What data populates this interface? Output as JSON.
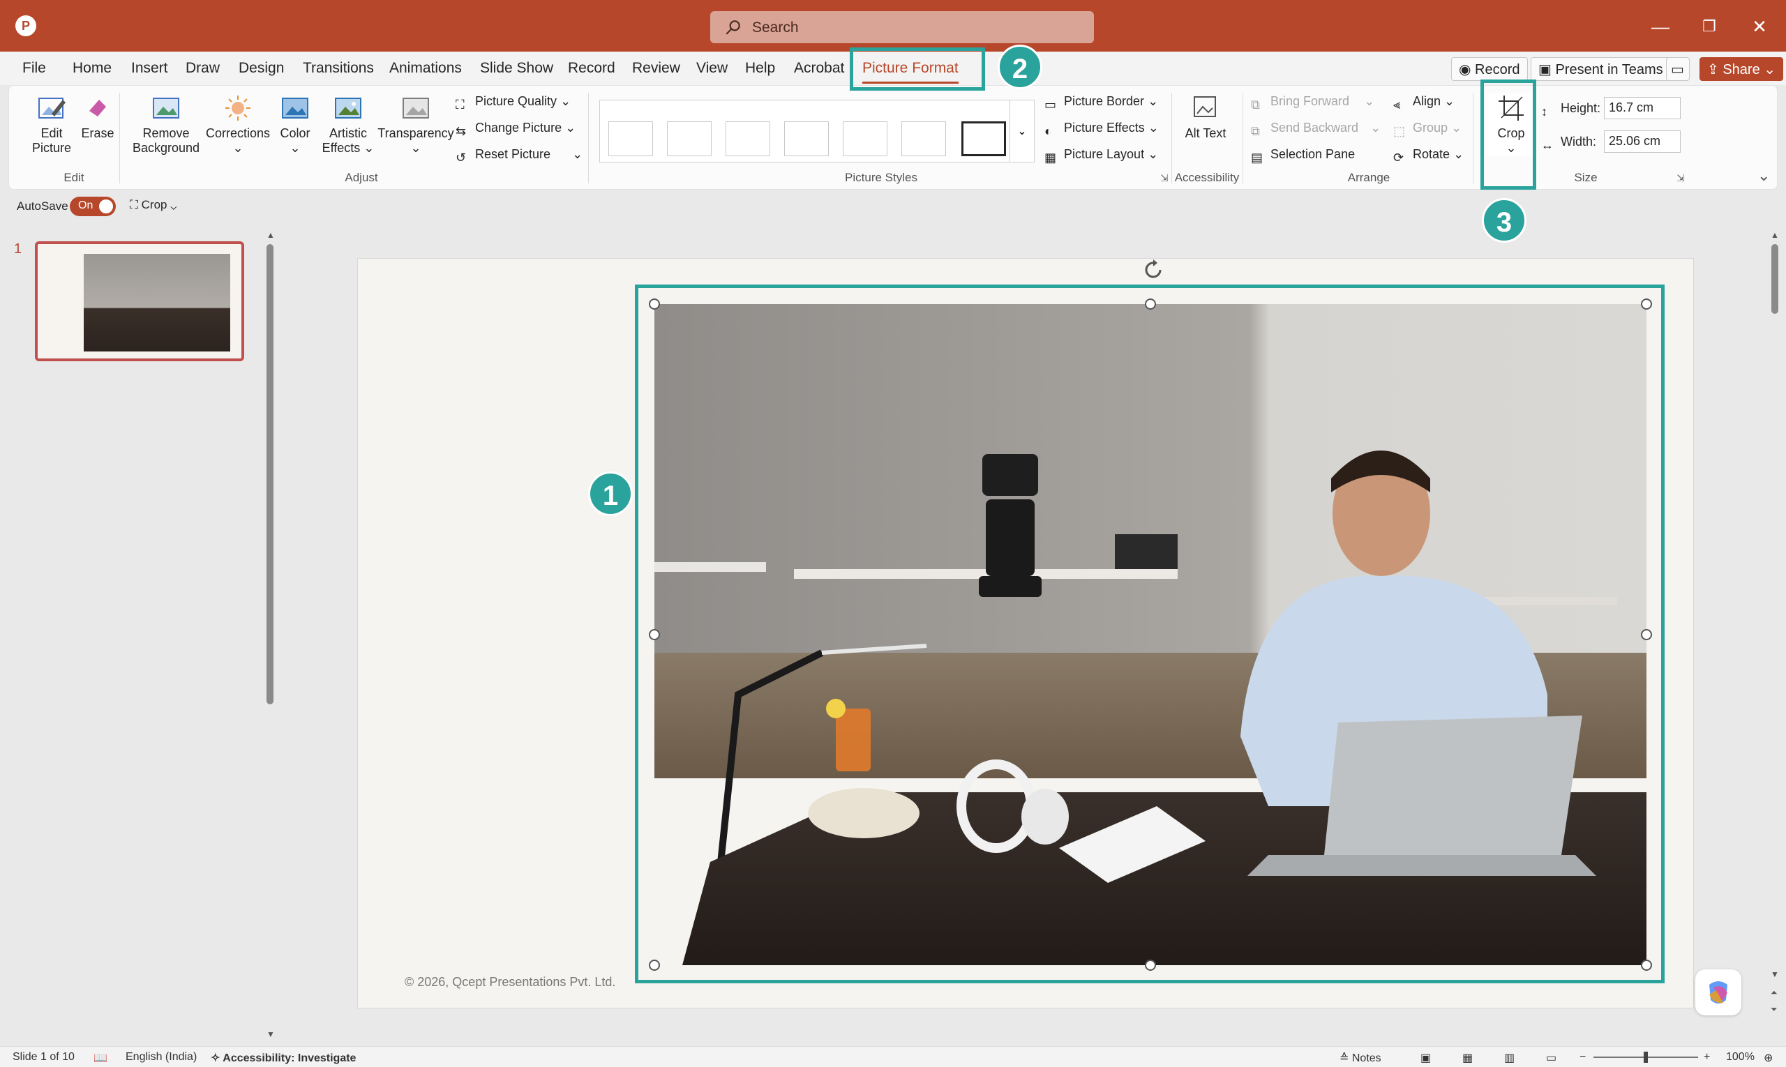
{
  "titlebar": {
    "search_placeholder": "Search",
    "minimize": "—",
    "restore": "❐",
    "close": "✕"
  },
  "menu_tabs": [
    "File",
    "Home",
    "Insert",
    "Draw",
    "Design",
    "Transitions",
    "Animations",
    "Slide Show",
    "Record",
    "Review",
    "View",
    "Help",
    "Acrobat",
    "Picture Format"
  ],
  "active_tab": "Picture Format",
  "top_buttons": {
    "record": "Record",
    "present_in_teams": "Present in Teams",
    "share": "Share"
  },
  "ribbon": {
    "edit": {
      "edit_picture": "Edit Picture",
      "erase": "Erase",
      "label": "Edit"
    },
    "adjust": {
      "remove_background": "Remove Background",
      "corrections": "Corrections",
      "color": "Color",
      "artistic_effects": "Artistic Effects",
      "transparency": "Transparency",
      "picture_quality": "Picture Quality",
      "change_picture": "Change Picture",
      "reset_picture": "Reset Picture",
      "label": "Adjust"
    },
    "picture_styles": {
      "label": "Picture Styles",
      "picture_border": "Picture Border",
      "picture_effects": "Picture Effects",
      "picture_layout": "Picture Layout"
    },
    "accessibility": {
      "alt_text": "Alt Text",
      "label": "Accessibility"
    },
    "arrange": {
      "bring_forward": "Bring Forward",
      "send_backward": "Send Backward",
      "selection_pane": "Selection Pane",
      "align": "Align",
      "group": "Group",
      "rotate": "Rotate",
      "label": "Arrange"
    },
    "size": {
      "crop": "Crop",
      "height_label": "Height:",
      "height_value": "16.7 cm",
      "width_label": "Width:",
      "width_value": "25.06 cm",
      "label": "Size"
    }
  },
  "qat": {
    "autosave": "AutoSave",
    "autosave_state": "On",
    "crop": "Crop"
  },
  "thumbnails": {
    "slide_number": "1"
  },
  "slide": {
    "copyright": "© 2026, Qcept Presentations Pvt. Ltd."
  },
  "callouts": [
    "1",
    "2",
    "3"
  ],
  "statusbar": {
    "slide_info": "Slide 1 of 10",
    "language": "English (India)",
    "accessibility": "Accessibility: Investigate",
    "notes": "Notes",
    "zoom": "100%"
  },
  "colors": {
    "accent": "#b7472a",
    "highlight": "#2aa39c"
  }
}
